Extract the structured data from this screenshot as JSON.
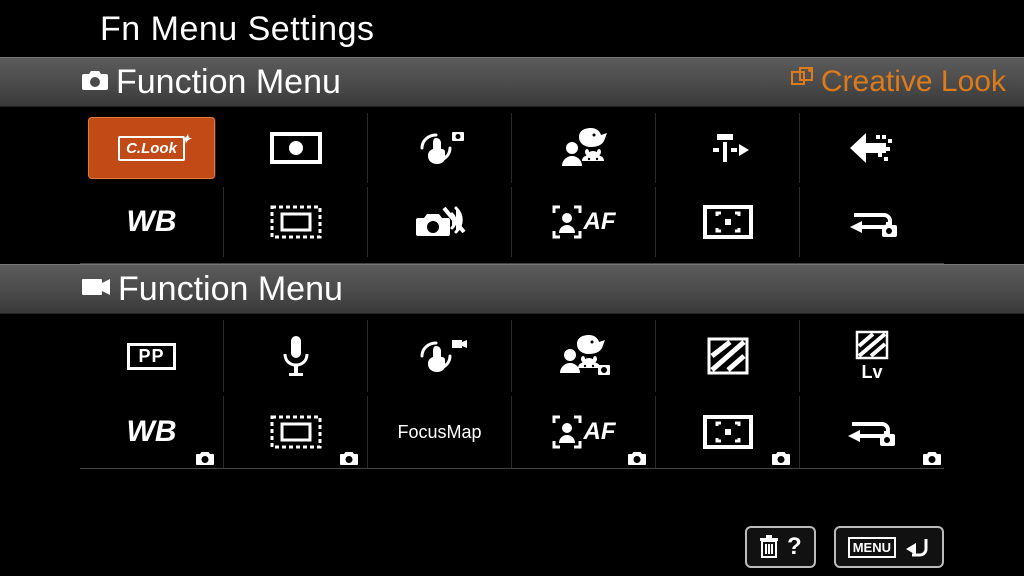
{
  "page_title": "Fn Menu Settings",
  "selected_item_label": "Creative Look",
  "sections": {
    "photo": {
      "label": "Function Menu",
      "items": [
        {
          "id": "creative-look",
          "label": "C.Look",
          "selected": true
        },
        {
          "id": "metering-mode"
        },
        {
          "id": "steadyshot-photo"
        },
        {
          "id": "subject-recognition"
        },
        {
          "id": "drive-mode"
        },
        {
          "id": "grid-display"
        },
        {
          "id": "white-balance",
          "label": "WB"
        },
        {
          "id": "aps-c-frame"
        },
        {
          "id": "silent-mode"
        },
        {
          "id": "face-eye-af",
          "label": "AF"
        },
        {
          "id": "focus-area"
        },
        {
          "id": "shoot-mode-dial"
        }
      ]
    },
    "video": {
      "label": "Function Menu",
      "items": [
        {
          "id": "picture-profile",
          "label": "PP"
        },
        {
          "id": "audio-rec"
        },
        {
          "id": "steadyshot-video"
        },
        {
          "id": "subject-recognition-video"
        },
        {
          "id": "zebra"
        },
        {
          "id": "zebra-level",
          "label": "Lv"
        },
        {
          "id": "white-balance-video",
          "label": "WB"
        },
        {
          "id": "aps-c-frame-video"
        },
        {
          "id": "focus-map",
          "label": "FocusMap"
        },
        {
          "id": "face-eye-af-video",
          "label": "AF"
        },
        {
          "id": "focus-area-video"
        },
        {
          "id": "shoot-mode-dial-video"
        }
      ]
    }
  },
  "footer": {
    "help": "?",
    "menu": "MENU"
  }
}
